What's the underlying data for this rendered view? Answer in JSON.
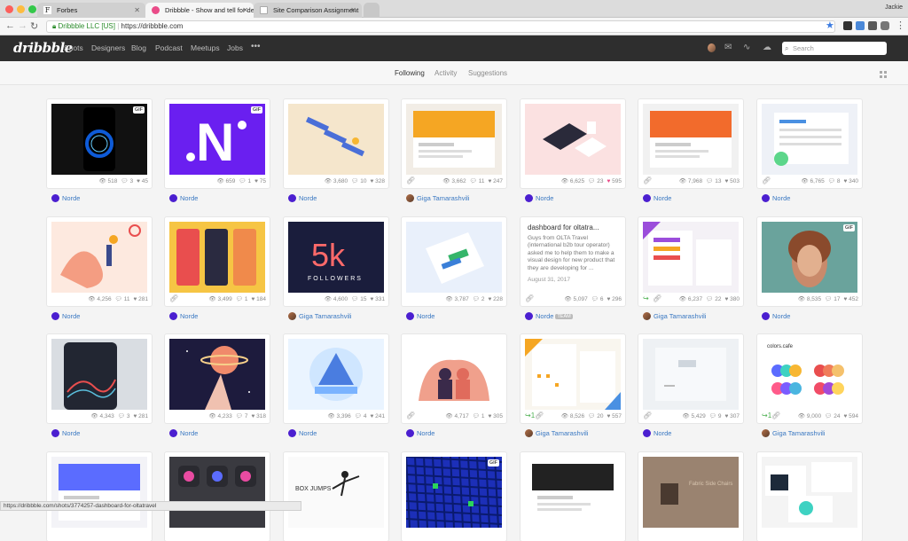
{
  "browser": {
    "tabs": [
      {
        "title": "Forbes",
        "fav": "#ffffff",
        "fav_text": "F"
      },
      {
        "title": "Dribbble - Show and tell for de",
        "fav": "#ea4c89",
        "fav_text": ""
      },
      {
        "title": "Site Comparison Assignment",
        "fav": "#bbbbbb",
        "fav_text": ""
      }
    ],
    "user": "Jackie",
    "secure": "Dribbble LLC [US]",
    "url": "https://dribbble.com"
  },
  "site": {
    "logo": "dribbble",
    "menu": [
      "Shots",
      "Designers",
      "Blog",
      "Podcast",
      "Meetups",
      "Jobs",
      "•••"
    ],
    "search_placeholder": "Search"
  },
  "subnav": [
    "Following",
    "Activity",
    "Suggestions"
  ],
  "shots": [
    {
      "views": "518",
      "comments": "3",
      "likes": "45",
      "author": "Norde",
      "gif": true,
      "bg": "#111111",
      "art": "ring",
      "fill": "#0e5bd8"
    },
    {
      "views": "659",
      "comments": "1",
      "likes": "75",
      "author": "Norde",
      "gif": true,
      "bg": "#6a1ff0",
      "art": "letter",
      "fill": "#ffffff"
    },
    {
      "views": "3,680",
      "comments": "10",
      "likes": "328",
      "author": "Norde",
      "gif": false,
      "bg": "#f5e6cc",
      "art": "chairs",
      "fill": "#4a6fd8"
    },
    {
      "views": "3,662",
      "comments": "11",
      "likes": "247",
      "author": "Giga Tamarashvili",
      "gif": false,
      "bg": "#f2ede6",
      "art": "web",
      "fill": "#f5a623",
      "attach": true,
      "photo": true
    },
    {
      "views": "6,625",
      "comments": "23",
      "likes": "595",
      "author": "Norde",
      "gif": false,
      "bg": "#fbe1e1",
      "art": "iso",
      "fill": "#2a2a3a",
      "liked": true
    },
    {
      "views": "7,968",
      "comments": "13",
      "likes": "503",
      "author": "Norde",
      "gif": false,
      "bg": "#f1f1f1",
      "art": "web",
      "fill": "#f26b2c",
      "attach": true
    },
    {
      "views": "6,765",
      "comments": "8",
      "likes": "340",
      "author": "Norde",
      "gif": false,
      "bg": "#eef1f7",
      "art": "dash",
      "fill": "#4a90e2",
      "attach": true
    },
    {
      "views": "4,256",
      "comments": "11",
      "likes": "281",
      "author": "Norde",
      "gif": false,
      "bg": "#fde9df",
      "art": "sport",
      "fill": "#f07c5a"
    },
    {
      "views": "3,499",
      "comments": "1",
      "likes": "184",
      "author": "Norde",
      "gif": false,
      "bg": "#f6c544",
      "art": "phones",
      "fill": "#e94e4e",
      "attach": true
    },
    {
      "views": "4,600",
      "comments": "15",
      "likes": "331",
      "author": "Giga Tamarashvili",
      "gif": false,
      "bg": "#1a1d3c",
      "art": "5k",
      "fill": "#ff6a6a",
      "photo": true
    },
    {
      "views": "3,787",
      "comments": "2",
      "likes": "228",
      "author": "Norde",
      "gif": false,
      "bg": "#e9f0fb",
      "art": "phone3d",
      "fill": "#35b56a"
    },
    {
      "views": "5,097",
      "comments": "6",
      "likes": "296",
      "author": "Norde",
      "gif": false,
      "bg": "#ffffff",
      "art": "text",
      "fill": "#333333",
      "attach": true,
      "team": "TEAM",
      "text_title": "dashboard for oltatra...",
      "text_body": "Guys from OLTA Travel (international b2b tour operator) asked me to help them to make a visual design for new product that they are developing for ...",
      "text_date": "August 31, 2017"
    },
    {
      "views": "6,237",
      "comments": "22",
      "likes": "380",
      "author": "Giga Tamarashvili",
      "gif": false,
      "bg": "#f4f1f6",
      "art": "app",
      "fill": "#9b4ddb",
      "attach": true,
      "photo": true,
      "rebound": true
    },
    {
      "views": "8,535",
      "comments": "17",
      "likes": "452",
      "author": "Norde",
      "gif": true,
      "bg": "#6aa39c",
      "art": "portrait",
      "fill": "#c98a6b"
    },
    {
      "views": "4,343",
      "comments": "3",
      "likes": "281",
      "author": "Norde",
      "gif": false,
      "bg": "#d9dde2",
      "art": "darkphone",
      "fill": "#222632"
    },
    {
      "views": "4,233",
      "comments": "7",
      "likes": "318",
      "author": "Norde",
      "gif": false,
      "bg": "#1d1b3d",
      "art": "planet",
      "fill": "#f08a6b"
    },
    {
      "views": "3,396",
      "comments": "4",
      "likes": "241",
      "author": "Norde",
      "gif": false,
      "bg": "#eaf4ff",
      "art": "badge",
      "fill": "#4a7de0"
    },
    {
      "views": "4,717",
      "comments": "1",
      "likes": "305",
      "author": "Norde",
      "gif": false,
      "bg": "#ffffff",
      "art": "couple",
      "fill": "#f0a08c",
      "attach": true
    },
    {
      "views": "8,526",
      "comments": "20",
      "likes": "557",
      "author": "Giga Tamarashvili",
      "gif": false,
      "bg": "#f9f6ef",
      "art": "calendar",
      "fill": "#f5a623",
      "attach": true,
      "photo": true,
      "rebound": true,
      "rebound_count": "1"
    },
    {
      "views": "5,429",
      "comments": "9",
      "likes": "307",
      "author": "Norde",
      "gif": false,
      "bg": "#eef1f4",
      "art": "minimal",
      "fill": "#cfd6dd",
      "attach": true
    },
    {
      "views": "9,000",
      "comments": "24",
      "likes": "594",
      "author": "Giga Tamarashvili",
      "gif": false,
      "bg": "#ffffff",
      "art": "colors",
      "fill": "#f14c67",
      "attach": true,
      "photo": true,
      "rebound": true,
      "rebound_count": "1",
      "title_text": "colors.cafe"
    },
    {
      "bg": "#f3f3f7",
      "art": "web",
      "fill": "#5b6cff"
    },
    {
      "bg": "#3a3a40",
      "art": "icons",
      "fill": "#e94ba1"
    },
    {
      "bg": "#fafafa",
      "art": "dancer",
      "fill": "#222222",
      "title_text": "BOX JUMPS"
    },
    {
      "bg": "#1c2fb8",
      "art": "mapgrid",
      "fill": "#2bd55b",
      "gif": true
    },
    {
      "bg": "#ffffff",
      "art": "web",
      "fill": "#222222"
    },
    {
      "bg": "#8a7463",
      "art": "chairphoto",
      "fill": "#d8c6b0",
      "title_text": "Fabric Side Chairs"
    },
    {
      "bg": "#f4f4f4",
      "art": "slides",
      "fill": "#3ed2c2"
    }
  ],
  "status_url": "https://dribbble.com/shots/3774257-dashboard-for-oltatravel"
}
